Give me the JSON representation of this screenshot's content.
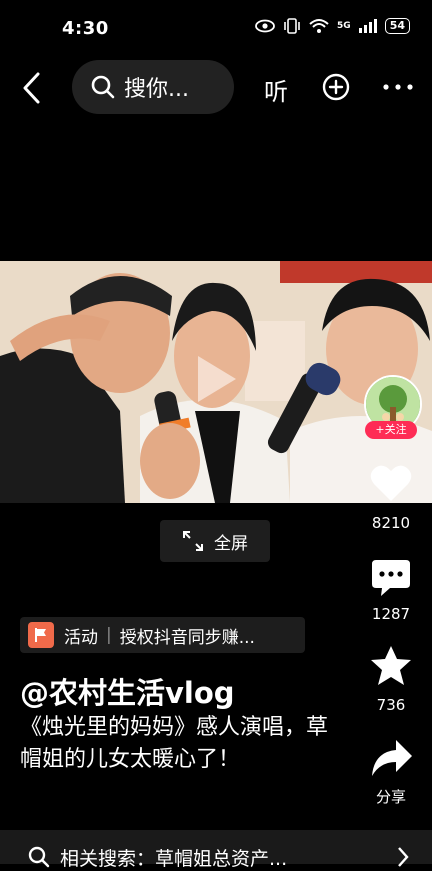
{
  "status": {
    "time": "4:30",
    "network": "5G",
    "battery": "54"
  },
  "topbar": {
    "search_text": "搜你...",
    "listen_label": "听"
  },
  "player": {
    "fullscreen_label": "全屏"
  },
  "rail": {
    "follow_label": "+关注",
    "likes": "8210",
    "comments": "1287",
    "favorites": "736",
    "share_label": "分享"
  },
  "activity": {
    "tag": "活动",
    "text": "授权抖音同步赚..."
  },
  "post": {
    "author": "@农村生活vlog",
    "description": "《烛光里的妈妈》感人演唱，草帽姐的儿女太暖心了！"
  },
  "related": {
    "text": "相关搜索：草帽姐总资产..."
  },
  "colors": {
    "background": "#000000",
    "follow_accent": "#fe2c55",
    "activity_flag": "#f06a4a"
  }
}
